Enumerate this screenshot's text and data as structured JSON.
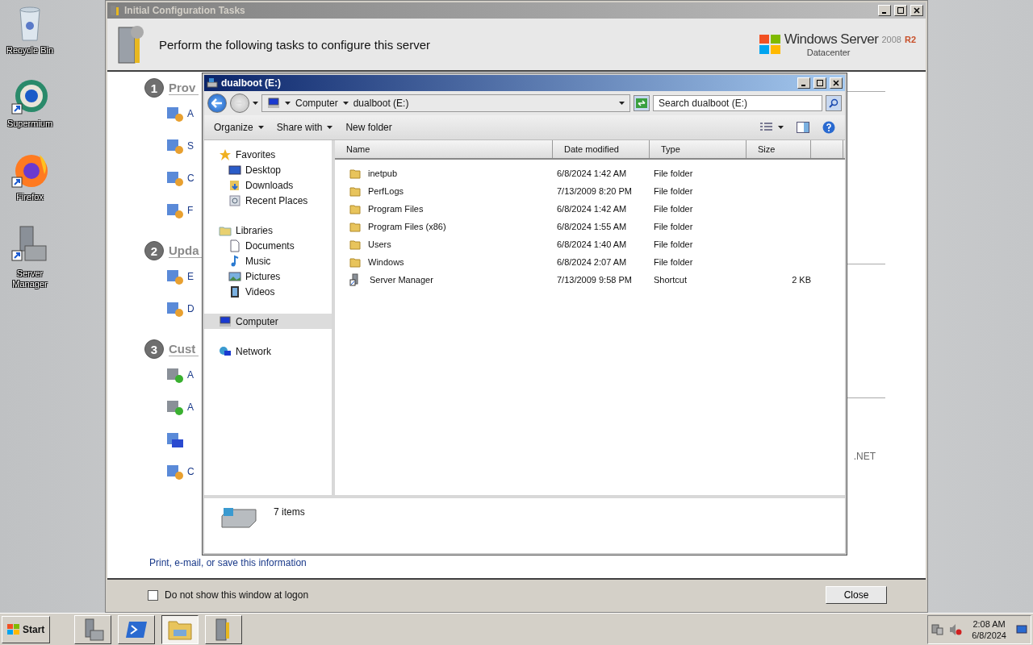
{
  "desktop_icons": [
    {
      "label": "Recycle Bin",
      "kind": "recycle"
    },
    {
      "label": "Supermium",
      "kind": "browser"
    },
    {
      "label": "Firefox",
      "kind": "firefox"
    },
    {
      "label": "Server Manager",
      "kind": "server"
    }
  ],
  "config_window": {
    "title": "Initial Configuration Tasks",
    "header": "Perform the following tasks to configure this server",
    "brand": {
      "name": "Windows Server",
      "version": "2008",
      "release": "R2",
      "edition": "Datacenter"
    },
    "sections": [
      {
        "number": "1",
        "heading": "Prov",
        "items": [
          {
            "label": "A"
          },
          {
            "label": "S"
          },
          {
            "label": "C"
          },
          {
            "label": "F"
          }
        ]
      },
      {
        "number": "2",
        "heading": "Upda",
        "items": [
          {
            "label": "E"
          },
          {
            "label": "D"
          }
        ]
      },
      {
        "number": "3",
        "heading": "Cust",
        "items": [
          {
            "label": "A"
          },
          {
            "label": "A"
          },
          {
            "kind": "unlabeled"
          },
          {
            "label": "C"
          }
        ]
      }
    ],
    "side_text": ".NET",
    "print_link": "Print, e-mail, or save this information",
    "dont_show": {
      "label": "Do not show this window at logon",
      "checked": false
    },
    "close_button": "Close"
  },
  "explorer": {
    "title": "dualboot (E:)",
    "breadcrumb": [
      "Computer",
      "dualboot (E:)"
    ],
    "search": {
      "placeholder": "Search dualboot (E:)"
    },
    "toolbar": [
      {
        "label": "Organize",
        "menu": true
      },
      {
        "label": "Share with",
        "menu": true
      },
      {
        "label": "New folder",
        "menu": false
      }
    ],
    "nav": [
      {
        "label": "Favorites",
        "kind": "star",
        "selected": false,
        "children": [
          {
            "label": "Desktop",
            "kind": "desktop"
          },
          {
            "label": "Downloads",
            "kind": "downloads"
          },
          {
            "label": "Recent Places",
            "kind": "recent"
          }
        ]
      },
      {
        "label": "Libraries",
        "kind": "library",
        "selected": false,
        "children": [
          {
            "label": "Documents",
            "kind": "document"
          },
          {
            "label": "Music",
            "kind": "music"
          },
          {
            "label": "Pictures",
            "kind": "pictures"
          },
          {
            "label": "Videos",
            "kind": "video"
          }
        ]
      },
      {
        "label": "Computer",
        "kind": "computer",
        "selected": true
      },
      {
        "label": "Network",
        "kind": "network",
        "selected": false
      }
    ],
    "columns": [
      "Name",
      "Date modified",
      "Type",
      "Size"
    ],
    "rows": [
      {
        "name": "inetpub",
        "date": "6/8/2024 1:42 AM",
        "type": "File folder",
        "kind": "folder"
      },
      {
        "name": "PerfLogs",
        "date": "7/13/2009 8:20 PM",
        "type": "File folder",
        "kind": "folder"
      },
      {
        "name": "Program Files",
        "date": "6/8/2024 1:42 AM",
        "type": "File folder",
        "kind": "folder"
      },
      {
        "name": "Program Files (x86)",
        "date": "6/8/2024 1:55 AM",
        "type": "File folder",
        "kind": "folder"
      },
      {
        "name": "Users",
        "date": "6/8/2024 1:40 AM",
        "type": "File folder",
        "kind": "folder"
      },
      {
        "name": "Windows",
        "date": "6/8/2024 2:07 AM",
        "type": "File folder",
        "kind": "folder"
      },
      {
        "name": "Server Manager",
        "date": "7/13/2009 9:58 PM",
        "type": "Shortcut",
        "size": "2 KB",
        "kind": "shortcut"
      }
    ],
    "status": "7 items"
  },
  "taskbar": {
    "start": "Start",
    "buttons": [
      {
        "kind": "server",
        "selected": false
      },
      {
        "kind": "powershell",
        "selected": false
      },
      {
        "kind": "explorer",
        "selected": true
      },
      {
        "kind": "config",
        "selected": false
      }
    ],
    "time": "2:08 AM",
    "date": "6/8/2024"
  }
}
